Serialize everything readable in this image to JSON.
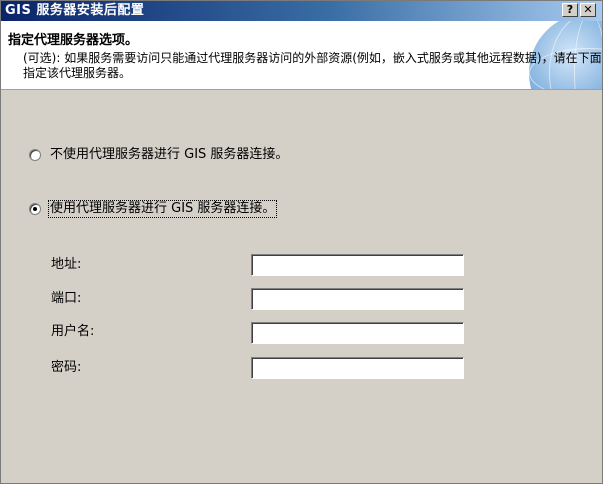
{
  "window": {
    "title": "GIS 服务器安装后配置",
    "help_glyph": "?",
    "close_glyph": "✕"
  },
  "header": {
    "title": "指定代理服务器选项。",
    "description": "(可选): 如果服务需要访问只能通过代理服务器访问的外部资源(例如，嵌入式服务或其他远程数据)，请在下面指定该代理服务器。"
  },
  "options": [
    {
      "label": "不使用代理服务器进行 GIS 服务器连接。",
      "selected": false
    },
    {
      "label": "使用代理服务器进行 GIS 服务器连接。",
      "selected": true
    }
  ],
  "fields": {
    "address_label": "地址:",
    "address_value": "",
    "port_label": "端口:",
    "port_value": "",
    "username_label": "用户名:",
    "username_value": "",
    "password_label": "密码:",
    "password_value": ""
  },
  "colors": {
    "titlebar_start": "#0a246a",
    "titlebar_end": "#a6caf0",
    "dialog_bg": "#d4d0c8"
  }
}
